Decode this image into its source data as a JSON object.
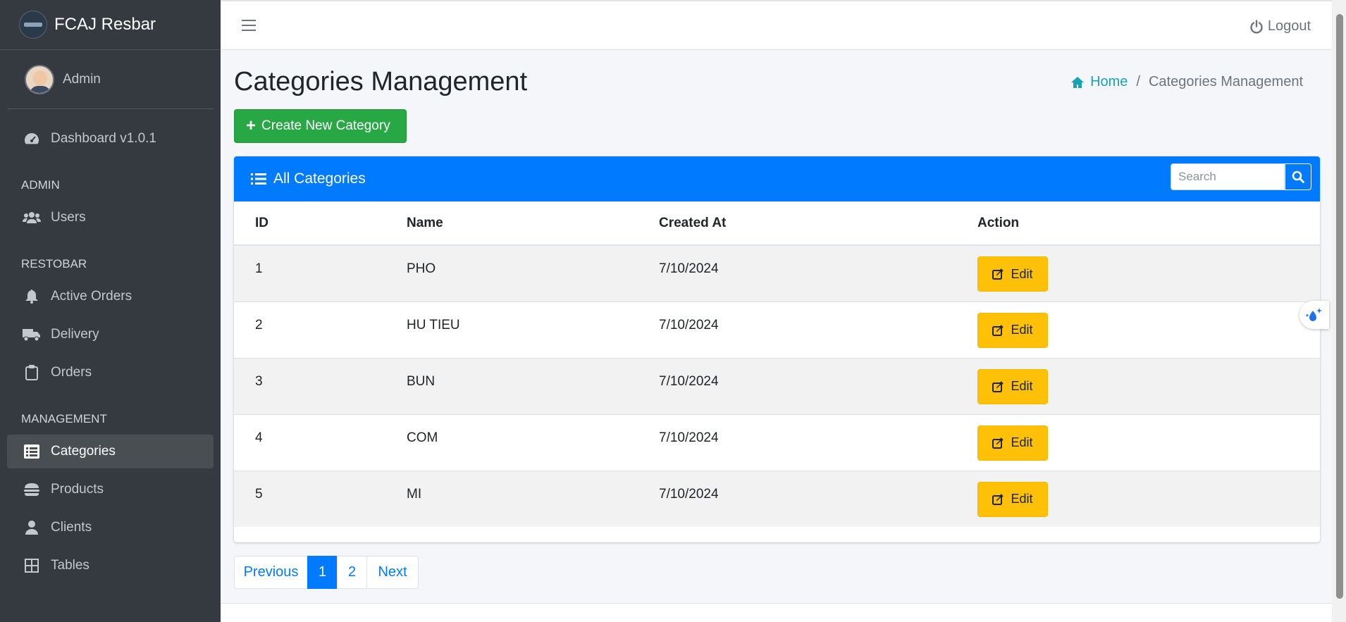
{
  "brand": {
    "name": "FCAJ Resbar"
  },
  "user": {
    "name": "Admin"
  },
  "sidebar": {
    "dashboard": "Dashboard v1.0.1",
    "sections": [
      {
        "header": "ADMIN",
        "items": [
          {
            "label": "Users",
            "icon": "users-icon"
          }
        ]
      },
      {
        "header": "RESTOBAR",
        "items": [
          {
            "label": "Active Orders",
            "icon": "bell-icon"
          },
          {
            "label": "Delivery",
            "icon": "truck-icon"
          },
          {
            "label": "Orders",
            "icon": "clipboard-icon"
          }
        ]
      },
      {
        "header": "MANAGEMENT",
        "items": [
          {
            "label": "Categories",
            "icon": "list-icon",
            "active": true
          },
          {
            "label": "Products",
            "icon": "burger-icon"
          },
          {
            "label": "Clients",
            "icon": "user-icon"
          },
          {
            "label": "Tables",
            "icon": "grid-icon"
          }
        ]
      }
    ]
  },
  "topbar": {
    "logout_label": "Logout"
  },
  "page": {
    "title": "Categories Management",
    "breadcrumb": {
      "home": "Home",
      "current": "Categories Management"
    },
    "create_button": "Create New Category"
  },
  "card": {
    "title": "All Categories",
    "search_placeholder": "Search",
    "columns": [
      "ID",
      "Name",
      "Created At",
      "Action"
    ],
    "edit_label": "Edit",
    "rows": [
      {
        "id": "1",
        "name": "PHO",
        "created": "7/10/2024"
      },
      {
        "id": "2",
        "name": "HU TIEU",
        "created": "7/10/2024"
      },
      {
        "id": "3",
        "name": "BUN",
        "created": "7/10/2024"
      },
      {
        "id": "4",
        "name": "COM",
        "created": "7/10/2024"
      },
      {
        "id": "5",
        "name": "MI",
        "created": "7/10/2024"
      }
    ]
  },
  "pagination": {
    "previous": "Previous",
    "pages": [
      "1",
      "2"
    ],
    "current": "1",
    "next": "Next"
  },
  "colors": {
    "primary": "#007bff",
    "success": "#28a745",
    "warning": "#ffc107",
    "sidebar": "#343a40",
    "info": "#17a2b8"
  }
}
